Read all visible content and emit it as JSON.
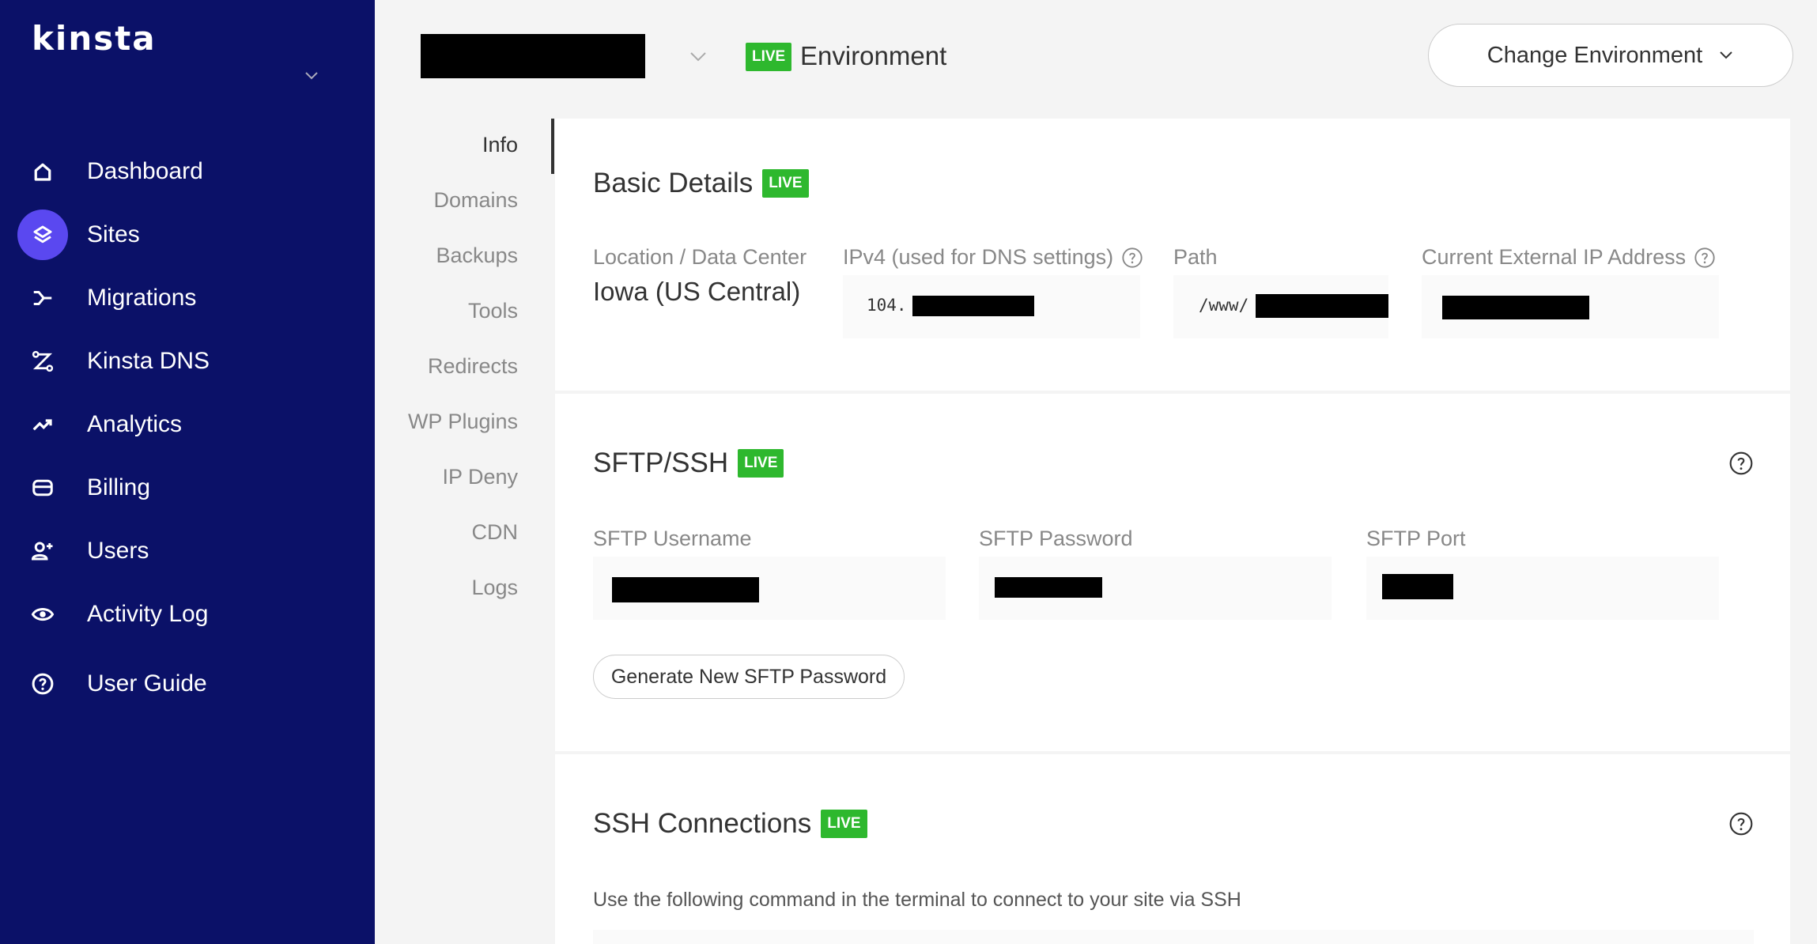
{
  "brand": {
    "logo_text": "kinsta"
  },
  "sidebar": {
    "items": [
      {
        "label": "Dashboard",
        "icon": "home-icon",
        "active": false
      },
      {
        "label": "Sites",
        "icon": "layers-icon",
        "active": true
      },
      {
        "label": "Migrations",
        "icon": "migrations-icon",
        "active": false
      },
      {
        "label": "Kinsta DNS",
        "icon": "dns-icon",
        "active": false
      },
      {
        "label": "Analytics",
        "icon": "analytics-icon",
        "active": false
      },
      {
        "label": "Billing",
        "icon": "billing-icon",
        "active": false
      },
      {
        "label": "Users",
        "icon": "add-user-icon",
        "active": false
      },
      {
        "label": "Activity Log",
        "icon": "eye-icon",
        "active": false
      },
      {
        "label": "User Guide",
        "icon": "help-circle-icon",
        "active": false
      }
    ]
  },
  "header": {
    "live_badge": "LIVE",
    "environment_label": "Environment",
    "change_env_label": "Change Environment"
  },
  "subnav": {
    "items": [
      "Info",
      "Domains",
      "Backups",
      "Tools",
      "Redirects",
      "WP Plugins",
      "IP Deny",
      "CDN",
      "Logs"
    ],
    "active": "Info"
  },
  "basic_details": {
    "title": "Basic Details",
    "badge": "LIVE",
    "location_label": "Location / Data Center",
    "location_value": "Iowa (US Central)",
    "ipv4_label": "IPv4 (used for DNS settings)",
    "ipv4_prefix": "104.",
    "path_label": "Path",
    "path_prefix": "/www/",
    "external_ip_label": "Current External IP Address"
  },
  "sftp": {
    "title": "SFTP/SSH",
    "badge": "LIVE",
    "username_label": "SFTP Username",
    "password_label": "SFTP Password",
    "port_label": "SFTP Port",
    "generate_button": "Generate New SFTP Password"
  },
  "ssh": {
    "title": "SSH Connections",
    "badge": "LIVE",
    "description": "Use the following command in the terminal to connect to your site via SSH"
  },
  "colors": {
    "sidebar_bg": "#0b1168",
    "active_icon_bg": "#5a48f0",
    "live_badge": "#2eb82e"
  }
}
